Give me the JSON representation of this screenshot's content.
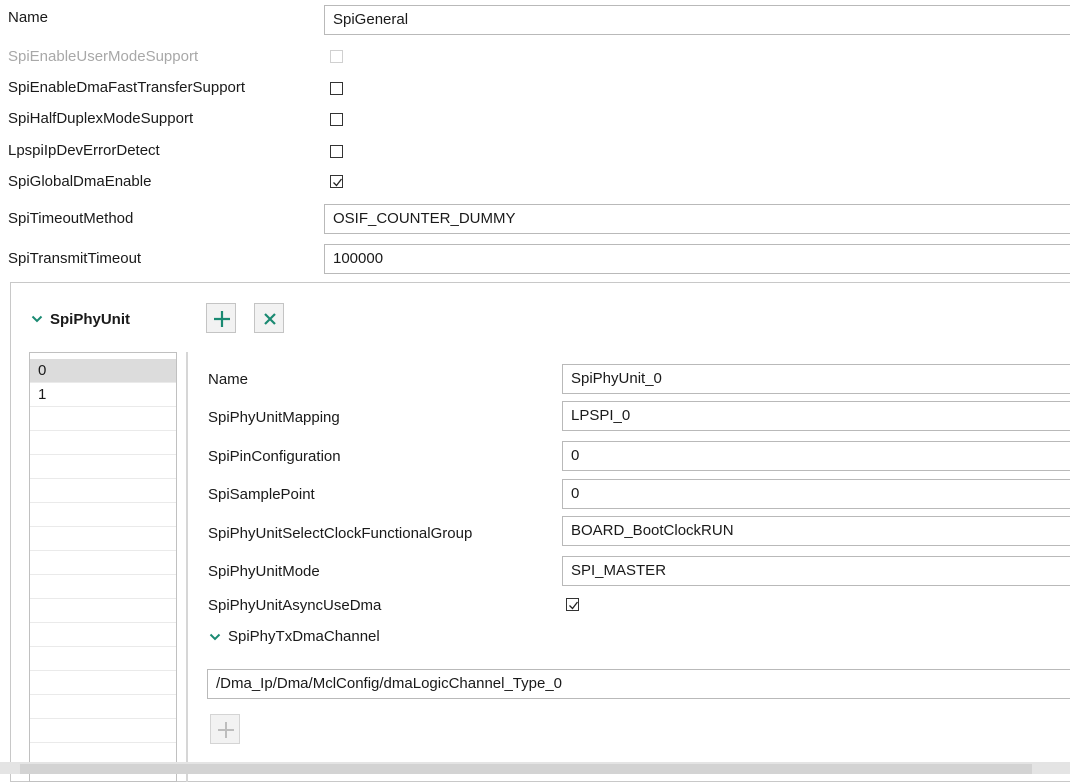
{
  "general": {
    "fields": [
      {
        "label": "Name",
        "value": "SpiGeneral",
        "type": "text"
      },
      {
        "label": "SpiEnableUserModeSupport",
        "checked": false,
        "type": "checkbox",
        "disabled": true
      },
      {
        "label": "SpiEnableDmaFastTransferSupport",
        "checked": false,
        "type": "checkbox"
      },
      {
        "label": "SpiHalfDuplexModeSupport",
        "checked": false,
        "type": "checkbox"
      },
      {
        "label": "LpspiIpDevErrorDetect",
        "checked": false,
        "type": "checkbox"
      },
      {
        "label": "SpiGlobalDmaEnable",
        "checked": true,
        "type": "checkbox"
      },
      {
        "label": "SpiTimeoutMethod",
        "value": "OSIF_COUNTER_DUMMY",
        "type": "text"
      },
      {
        "label": "SpiTransmitTimeout",
        "value": "100000",
        "type": "text"
      }
    ]
  },
  "phy_unit": {
    "title": "SpiPhyUnit",
    "add_icon": "plus-icon",
    "remove_icon": "x-icon",
    "list_items": [
      "0",
      "1"
    ],
    "selected_index": 0,
    "fields": [
      {
        "label": "Name",
        "value": "SpiPhyUnit_0",
        "type": "text"
      },
      {
        "label": "SpiPhyUnitMapping",
        "value": "LPSPI_0",
        "type": "text"
      },
      {
        "label": "SpiPinConfiguration",
        "value": "0",
        "type": "text"
      },
      {
        "label": "SpiSamplePoint",
        "value": "0",
        "type": "text"
      },
      {
        "label": "SpiPhyUnitSelectClockFunctionalGroup",
        "value": "BOARD_BootClockRUN",
        "type": "text"
      },
      {
        "label": "SpiPhyUnitMode",
        "value": "SPI_MASTER",
        "type": "text"
      },
      {
        "label": "SpiPhyUnitAsyncUseDma",
        "checked": true,
        "type": "checkbox"
      }
    ],
    "tx_dma": {
      "title": "SpiPhyTxDmaChannel",
      "value": "/Dma_Ip/Dma/MclConfig/dmaLogicChannel_Type_0",
      "add_icon": "plus-icon"
    }
  },
  "colors": {
    "accent": "#1a8a72",
    "disabled_text": "#a8a8a8",
    "selection": "#dcdcdc"
  }
}
